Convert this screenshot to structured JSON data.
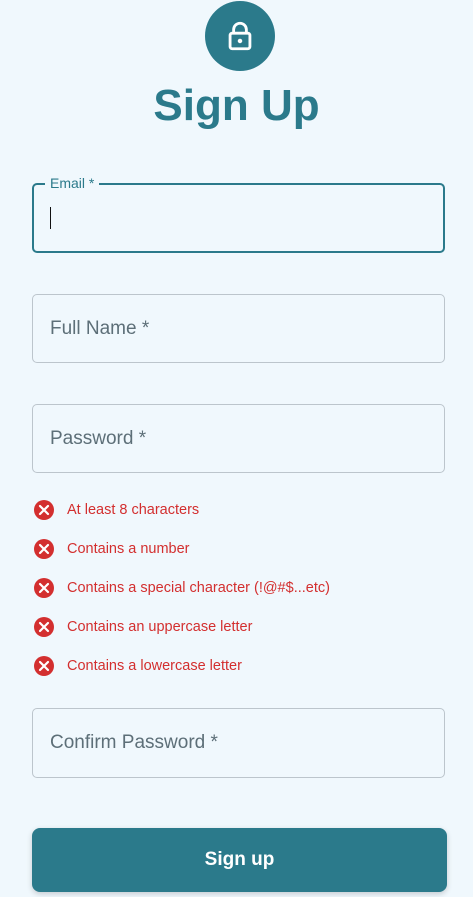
{
  "header": {
    "icon": "lock-icon",
    "title": "Sign Up"
  },
  "form": {
    "email": {
      "label": "Email *",
      "value": "",
      "focused": true
    },
    "full_name": {
      "placeholder": "Full Name *",
      "value": ""
    },
    "password": {
      "placeholder": "Password *",
      "value": ""
    },
    "password_rules": [
      {
        "text": "At least 8 characters",
        "met": false,
        "icon": "error-x-icon"
      },
      {
        "text": "Contains a number",
        "met": false,
        "icon": "error-x-icon"
      },
      {
        "text": "Contains a special character (!@#$...etc)",
        "met": false,
        "icon": "error-x-icon"
      },
      {
        "text": "Contains an uppercase letter",
        "met": false,
        "icon": "error-x-icon"
      },
      {
        "text": "Contains a lowercase letter",
        "met": false,
        "icon": "error-x-icon"
      }
    ],
    "confirm_password": {
      "placeholder": "Confirm Password *",
      "value": ""
    },
    "submit_label": "Sign up"
  },
  "colors": {
    "background": "#f0f8fd",
    "accent": "#2b7a8b",
    "error": "#d32f2f",
    "field_border": "#bcc5cc",
    "placeholder": "#5d6f78"
  }
}
